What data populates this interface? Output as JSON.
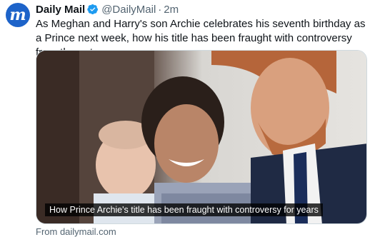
{
  "author": {
    "avatar_letter": "m",
    "name": "Daily Mail",
    "handle": "@DailyMail",
    "separator": "·",
    "time": "2m",
    "avatar_color": "#1d63c9",
    "verified_color": "#1d9bf0"
  },
  "tweet": {
    "text": "As Meghan and Harry's son Archie celebrates his seventh birthday as a Prince next week, how his title has been fraught with controversy from the get-go"
  },
  "media": {
    "caption": "How Prince Archie's title has been fraught with controversy for years"
  },
  "card": {
    "source": "From dailymail.com"
  }
}
